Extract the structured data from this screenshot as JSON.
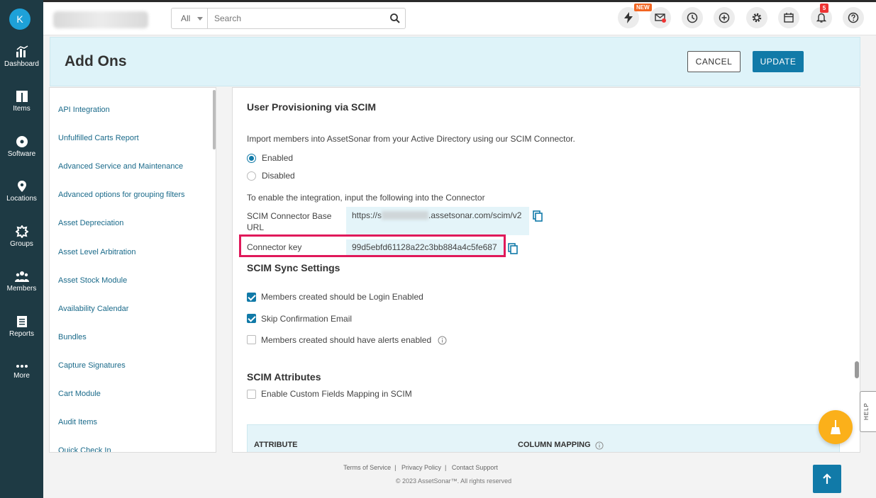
{
  "user": {
    "initial": "K"
  },
  "nav": {
    "items": [
      {
        "label": "Dashboard",
        "icon": "dashboard-icon"
      },
      {
        "label": "Items",
        "icon": "items-icon"
      },
      {
        "label": "Software",
        "icon": "software-icon"
      },
      {
        "label": "Locations",
        "icon": "location-pin-icon"
      },
      {
        "label": "Groups",
        "icon": "groups-icon"
      },
      {
        "label": "Members",
        "icon": "members-icon"
      },
      {
        "label": "Reports",
        "icon": "reports-icon"
      },
      {
        "label": "More",
        "icon": "more-dots-icon"
      }
    ]
  },
  "topbar": {
    "search_scope": "All",
    "search_placeholder": "Search",
    "new_badge": "NEW",
    "notification_count": "5"
  },
  "header": {
    "title": "Add Ons",
    "cancel_label": "CANCEL",
    "update_label": "UPDATE"
  },
  "side_menu": {
    "items": [
      "API Integration",
      "Unfulfilled Carts Report",
      "Advanced Service and Maintenance",
      "Advanced options for grouping filters",
      "Asset Depreciation",
      "Asset Level Arbitration",
      "Asset Stock Module",
      "Availability Calendar",
      "Bundles",
      "Capture Signatures",
      "Cart Module",
      "Audit Items",
      "Quick Check In"
    ]
  },
  "scim": {
    "title": "User Provisioning via SCIM",
    "description": "Import members into AssetSonar from your Active Directory using our SCIM Connector.",
    "enabled_label": "Enabled",
    "disabled_label": "Disabled",
    "selected": "Enabled",
    "instruction": "To enable the integration, input the following into the Connector",
    "base_url_label": "SCIM Connector Base URL",
    "base_url_prefix": "https://s",
    "base_url_suffix": ".assetsonar.com/scim/v2",
    "connector_key_label": "Connector key",
    "connector_key": "99d5ebfd61128a22c3bb884a4c5fe687"
  },
  "sync": {
    "title": "SCIM Sync Settings",
    "options": [
      {
        "label": "Members created should be Login Enabled",
        "checked": true
      },
      {
        "label": "Skip Confirmation Email",
        "checked": true
      },
      {
        "label": "Members created should have alerts enabled",
        "checked": false
      }
    ]
  },
  "attributes": {
    "title": "SCIM Attributes",
    "custom_mapping_label": "Enable Custom Fields Mapping in SCIM",
    "custom_mapping_checked": false,
    "col_attribute": "ATTRIBUTE",
    "col_mapping": "COLUMN MAPPING"
  },
  "help_tab": "HELP",
  "footer": {
    "terms": "Terms of Service",
    "privacy": "Privacy Policy",
    "contact": "Contact Support",
    "copyright": "© 2023 AssetSonar™. All rights reserved"
  },
  "colors": {
    "nav_bg": "#1e3a44",
    "accent": "#117aa8",
    "highlight": "#e0195a",
    "fab": "#fbb01a"
  }
}
